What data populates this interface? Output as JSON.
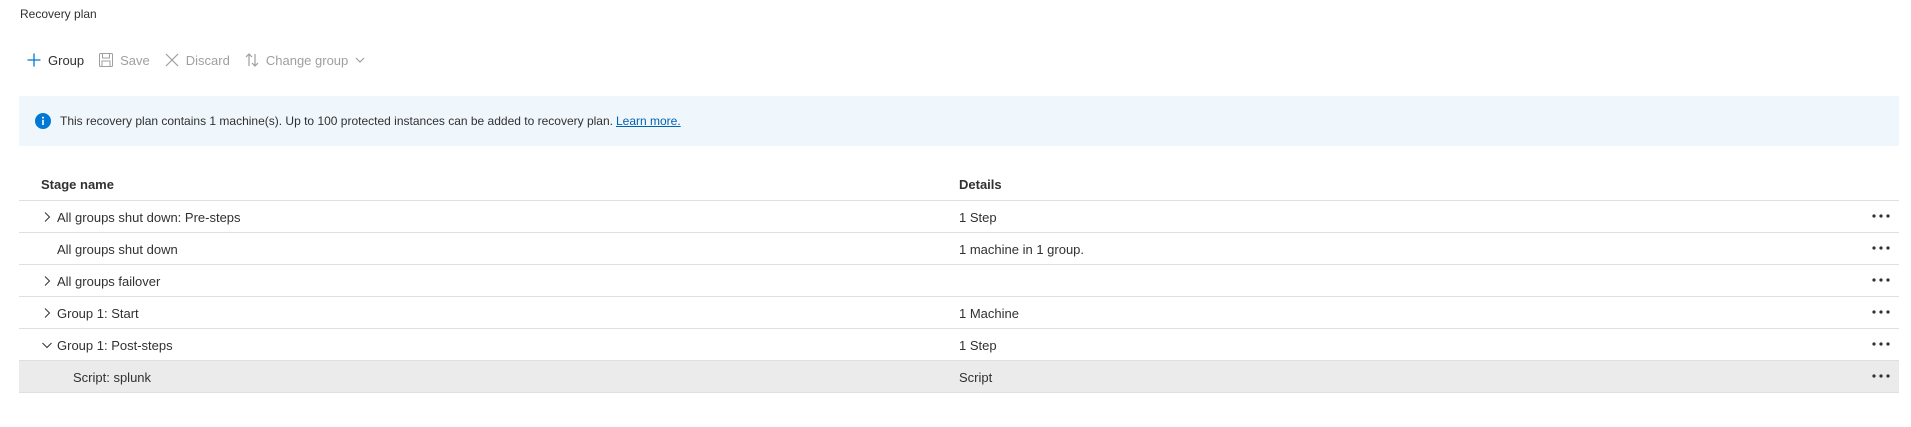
{
  "page_title": "Recovery plan",
  "toolbar": {
    "group_label": "Group",
    "save_label": "Save",
    "discard_label": "Discard",
    "change_group_label": "Change group"
  },
  "banner": {
    "text": "This recovery plan contains 1 machine(s). Up to 100 protected instances can be added to recovery plan.",
    "link": "Learn more."
  },
  "table": {
    "headers": {
      "stage": "Stage name",
      "details": "Details"
    },
    "rows": [
      {
        "name": "All groups shut down: Pre-steps",
        "details": "1 Step",
        "toggle": "collapsed"
      },
      {
        "name": "All groups shut down",
        "details": "1 machine in 1 group.",
        "toggle": "none"
      },
      {
        "name": "All groups failover",
        "details": "",
        "toggle": "collapsed"
      },
      {
        "name": "Group 1: Start",
        "details": "1 Machine",
        "toggle": "collapsed"
      },
      {
        "name": "Group 1: Post-steps",
        "details": "1 Step",
        "toggle": "expanded"
      },
      {
        "name": "Script: splunk",
        "details": "Script",
        "toggle": "none",
        "selected": true
      }
    ]
  },
  "colors": {
    "accent": "#0078d4",
    "banner_bg": "#eff6fc",
    "selected_row_bg": "#ebebeb",
    "disabled_text": "#a19f9d"
  }
}
